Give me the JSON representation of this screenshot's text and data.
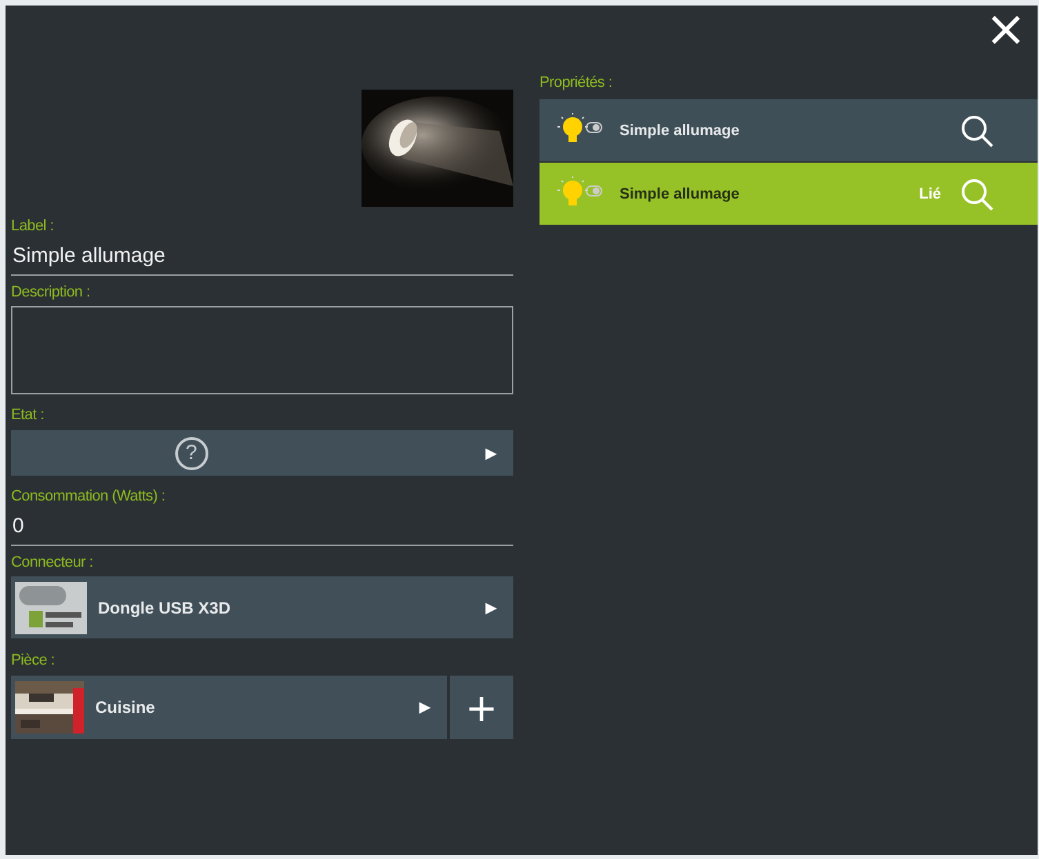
{
  "close": "×",
  "form": {
    "label": {
      "caption": "Label :",
      "value": "Simple allumage"
    },
    "description": {
      "caption": "Description :"
    },
    "state": {
      "caption": "Etat :",
      "symbol": "?",
      "arrow": "▶"
    },
    "consumption": {
      "caption": "Consommation (Watts) :",
      "value": "0"
    },
    "connector": {
      "caption": "Connecteur :",
      "value": "Dongle USB X3D",
      "arrow": "▶"
    },
    "room": {
      "caption": "Pièce :",
      "value": "Cuisine",
      "arrow": "▶",
      "add": "+"
    }
  },
  "properties": {
    "caption": "Propriétés :",
    "items": [
      {
        "label": "Simple allumage",
        "selected": false
      },
      {
        "label": "Simple allumage",
        "selected": true,
        "status": "Lié"
      }
    ]
  }
}
